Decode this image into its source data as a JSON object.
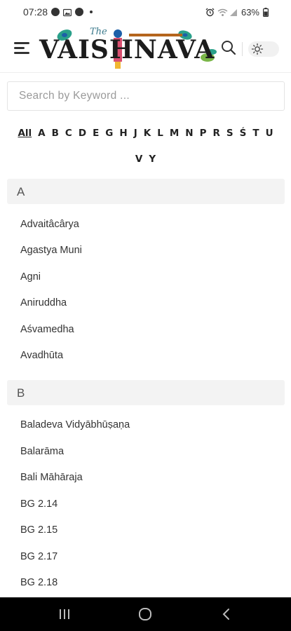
{
  "status_bar": {
    "time": "07:28",
    "battery": "63%",
    "icons_left": [
      "app-circle-icon",
      "gallery-icon",
      "facebook-icon",
      "dot-icon"
    ],
    "icons_right": [
      "alarm-icon",
      "wifi-icon",
      "signal-icon",
      "battery-icon"
    ]
  },
  "header": {
    "logo_prefix": "The",
    "logo_text": "VAISHNAVA",
    "accent_color": "#2aa08a"
  },
  "search": {
    "placeholder": "Search by Keyword ..."
  },
  "alphabet": {
    "row1": [
      "All",
      "A",
      "B",
      "C",
      "D",
      "E",
      "G",
      "H",
      "J",
      "K",
      "L",
      "M",
      "N",
      "P",
      "R",
      "S",
      "Ś",
      "T",
      "U"
    ],
    "row2": [
      "V",
      "Y"
    ],
    "active": "All"
  },
  "sections": [
    {
      "letter": "A",
      "entries": [
        "Advaitâcârya",
        "Agastya Muni",
        "Agni",
        "Aniruddha",
        "Aśvamedha",
        "Avadhūta"
      ]
    },
    {
      "letter": "B",
      "entries": [
        "Baladeva Vidyābhūṣaṇa",
        "Balarāma",
        "Bali Māhāraja",
        "BG 2.14",
        "BG 2.15",
        "BG 2.17",
        "BG 2.18"
      ]
    }
  ]
}
